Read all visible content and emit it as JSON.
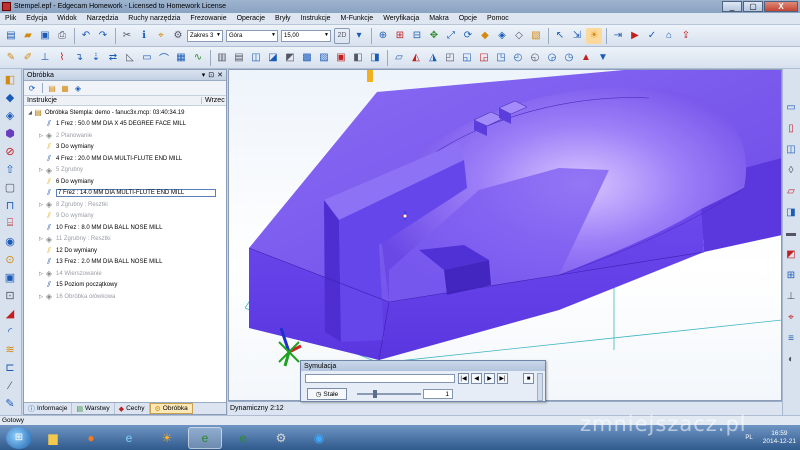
{
  "window": {
    "title": "Stempel.epf - Edgecam Homework - Licensed to Homework License",
    "controls": [
      "_",
      "▢",
      "X"
    ]
  },
  "menu": [
    "Plik",
    "Edycja",
    "Widok",
    "Narzędzia",
    "Ruchy narzędzia",
    "Frezowanie",
    "Operacje",
    "Bryły",
    "Instrukcje",
    "M-Funkcje",
    "Weryfikacja",
    "Makra",
    "Opcje",
    "Pomoc"
  ],
  "toolbar": {
    "range_value": "Zakres 3",
    "view_value": "Góra",
    "depth_value": "15,00",
    "mode_label": "2D"
  },
  "panel": {
    "title": "Obróbka",
    "column_instruction": "Instrukcje",
    "column_rapid": "Wrzec",
    "rows": [
      {
        "text": "Obróbka Stempla: demo - fanuc3x.mcp: 03:40:34.19",
        "icon": "root-icon",
        "level": 0,
        "muted": false
      },
      {
        "text": "1 Frez : 50.0 MM DIA X 45 DEGREE FACE MILL",
        "icon": "mill",
        "level": 1,
        "muted": false
      },
      {
        "text": "2 Planowanie",
        "icon": "group",
        "level": 1,
        "muted": true
      },
      {
        "text": "3 Do wymiany",
        "icon": "change",
        "level": 1,
        "muted": false
      },
      {
        "text": "4 Frez : 20.0 MM DIA MULTI-FLUTE END MILL",
        "icon": "mill",
        "level": 1,
        "muted": false
      },
      {
        "text": "5 Zgrubny",
        "icon": "group",
        "level": 1,
        "muted": true
      },
      {
        "text": "6 Do wymiany",
        "icon": "change",
        "level": 1,
        "muted": false
      },
      {
        "text": "7 Frez : 14.0 MM DIA MULTI-FLUTE END MILL",
        "icon": "mill",
        "level": 1,
        "muted": false,
        "selected": true
      },
      {
        "text": "8 Zgrubny : Resztki",
        "icon": "group",
        "level": 1,
        "muted": true
      },
      {
        "text": "9 Do wymiany",
        "icon": "change",
        "level": 1,
        "muted": true
      },
      {
        "text": "10 Frez : 8.0 MM DIA BALL NOSE MILL",
        "icon": "mill",
        "level": 1,
        "muted": false
      },
      {
        "text": "11 Zgrubny : Resztki",
        "icon": "group",
        "level": 1,
        "muted": true
      },
      {
        "text": "12 Do wymiany",
        "icon": "change",
        "level": 1,
        "muted": false
      },
      {
        "text": "13 Frez : 2.0 MM DIA BALL NOSE MILL",
        "icon": "mill",
        "level": 1,
        "muted": false
      },
      {
        "text": "14 Wierszowanie",
        "icon": "group",
        "level": 1,
        "muted": true
      },
      {
        "text": "15 Poziom początkowy",
        "icon": "mill",
        "level": 1,
        "muted": false
      },
      {
        "text": "16 Obróbka ołówkowa",
        "icon": "group",
        "level": 1,
        "muted": true
      }
    ],
    "tabs": [
      {
        "label": "Informacje",
        "icon": "info-icon",
        "active": false
      },
      {
        "label": "Warstwy",
        "icon": "layers-icon",
        "active": false
      },
      {
        "label": "Cechy",
        "icon": "features-icon",
        "active": false
      },
      {
        "label": "Obróbka",
        "icon": "machining-icon",
        "active": true
      }
    ]
  },
  "viewport": {
    "status": "Dynamiczny 2:12",
    "model_color": "#7a5cf0"
  },
  "simulation": {
    "title": "Symulacja",
    "button": "Stałe",
    "speed": "1",
    "controls": [
      "|◀",
      "◀",
      "▶",
      "▶|",
      "■"
    ]
  },
  "status_bar": "Gotowy",
  "taskbar": {
    "apps": [
      "explorer",
      "firefox",
      "ie",
      "sun",
      "edgecam",
      "edgecam",
      "tools",
      "ie"
    ],
    "lang": "PL",
    "time": "16:59",
    "date": "2014-12-21"
  },
  "watermark": "zmniejszacz.pl"
}
